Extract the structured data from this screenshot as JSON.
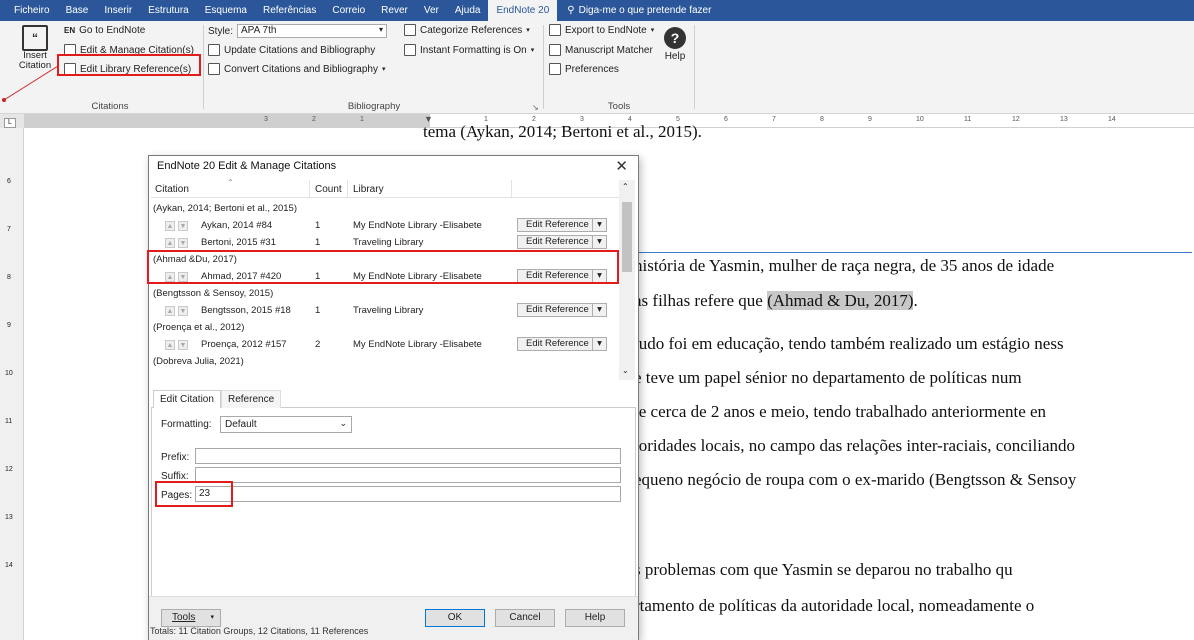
{
  "ribbon_tabs": [
    "Ficheiro",
    "Base",
    "Inserir",
    "Estrutura",
    "Esquema",
    "Referências",
    "Correio",
    "Rever",
    "Ver",
    "Ajuda",
    "EndNote 20"
  ],
  "tell_me": "Diga-me o que pretende fazer",
  "citations_group": {
    "insert_citation": "Insert Citation",
    "go_to_endnote": "Go to EndNote",
    "edit_manage": "Edit & Manage Citation(s)",
    "edit_library_ref": "Edit Library Reference(s)",
    "label": "Citations"
  },
  "bibliography_group": {
    "style_label": "Style:",
    "style_value": "APA 7th",
    "update": "Update Citations and Bibliography",
    "convert": "Convert Citations and Bibliography",
    "categorize": "Categorize References",
    "instant": "Instant Formatting is On",
    "label": "Bibliography"
  },
  "tools_group": {
    "export": "Export to EndNote",
    "matcher": "Manuscript Matcher",
    "preferences": "Preferences",
    "help": "Help",
    "label": "Tools"
  },
  "ruler_numbers": [
    "3",
    "2",
    "1",
    "1",
    "2",
    "3",
    "4",
    "5",
    "6",
    "7",
    "8",
    "9",
    "10",
    "11",
    "12",
    "13",
    "14"
  ],
  "vruler_numbers": [
    "6",
    "7",
    "8",
    "9",
    "10",
    "11",
    "12",
    "13",
    "14"
  ],
  "document": {
    "top_line": "tema (Aykan, 2014; Bertoni et al., 2015).",
    "lines": [
      "história de Yasmin, mulher de raça negra, de 35 anos de idade",
      "as filhas  refere que ",
      "tudo foi em educação, tendo também realizado um estágio ness",
      "e teve um papel sénior no departamento de políticas num",
      "te cerca de 2 anos e meio, tendo trabalhado anteriormente en",
      "toridades locais, no campo das relações inter-raciais, conciliando",
      "equeno negócio de roupa com o ex-marido (Bengtsson & Sensoy",
      "s problemas com que Yasmin se deparou no trabalho qu",
      "rtamento de políticas da autoridade local, nomeadamente o"
    ],
    "highlight": "(Ahmad & Du, 2017)",
    "period": "."
  },
  "dialog": {
    "title": "EndNote 20 Edit & Manage Citations",
    "col_citation": "Citation",
    "col_count": "Count",
    "col_library": "Library",
    "groups": [
      {
        "label": "(Aykan, 2014; Bertoni et al., 2015)",
        "items": [
          {
            "name": "Aykan, 2014 #84",
            "count": "1",
            "library": "My EndNote Library -Elisabete",
            "action": "Edit Reference"
          },
          {
            "name": "Bertoni, 2015 #31",
            "count": "1",
            "library": "Traveling Library",
            "action": "Edit Reference"
          }
        ]
      },
      {
        "label": "(Ahmad &Du, 2017)",
        "items": [
          {
            "name": "Ahmad, 2017 #420",
            "count": "1",
            "library": "My EndNote Library -Elisabete",
            "action": "Edit Reference"
          }
        ]
      },
      {
        "label": "(Bengtsson & Sensoy, 2015)",
        "items": [
          {
            "name": "Bengtsson, 2015 #18",
            "count": "1",
            "library": "Traveling Library",
            "action": "Edit Reference"
          }
        ]
      },
      {
        "label": "(Proença et al., 2012)",
        "items": [
          {
            "name": "Proença, 2012 #157",
            "count": "2",
            "library": "My EndNote Library -Elisabete",
            "action": "Edit Reference"
          }
        ]
      },
      {
        "label": "(Dobreva Julia, 2021)",
        "items": []
      }
    ],
    "tab_edit": "Edit Citation",
    "tab_reference": "Reference",
    "formatting_label": "Formatting:",
    "formatting_value": "Default",
    "prefix_label": "Prefix:",
    "suffix_label": "Suffix:",
    "pages_label": "Pages:",
    "pages_value": "23",
    "tools_btn": "Tools",
    "ok_btn": "OK",
    "cancel_btn": "Cancel",
    "help_btn": "Help",
    "totals": "Totals: 11 Citation Groups, 12 Citations, 11 References"
  }
}
